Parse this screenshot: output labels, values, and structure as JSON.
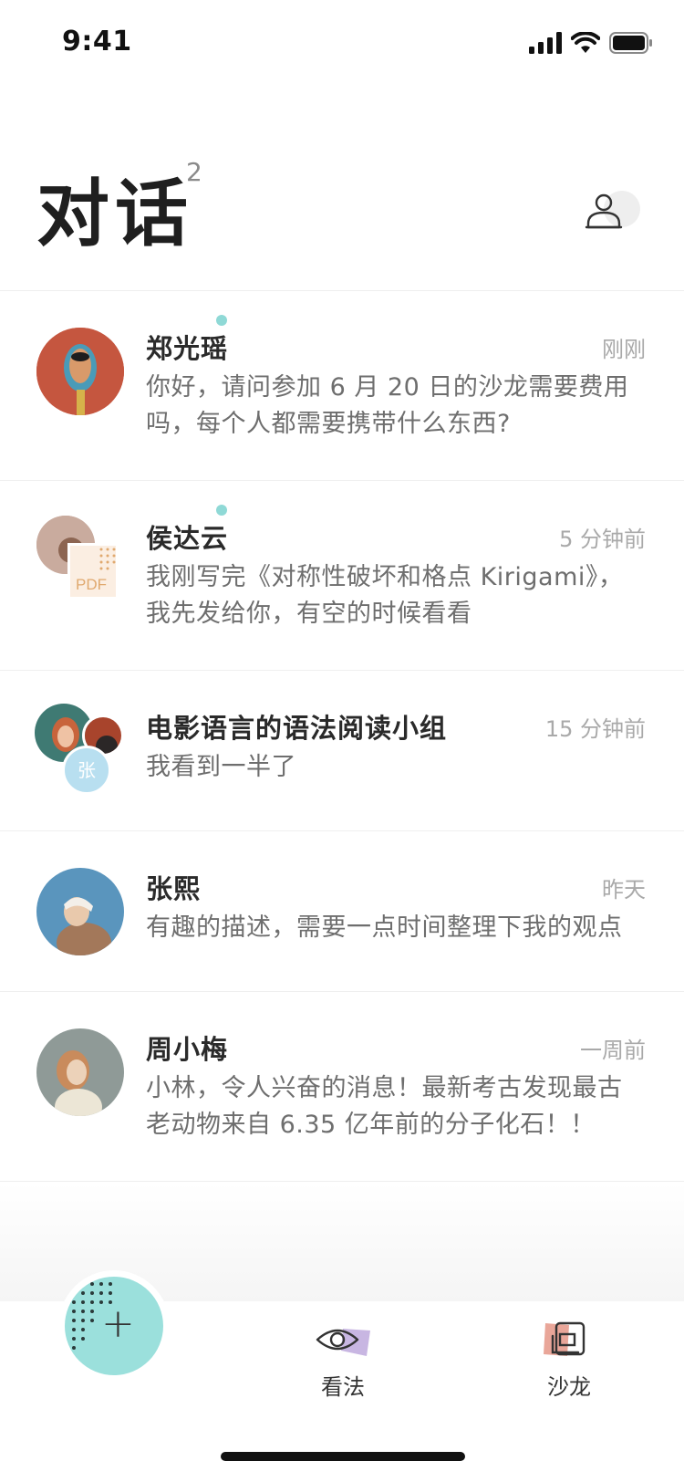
{
  "status_bar": {
    "time": "9:41"
  },
  "header": {
    "title": "对话",
    "badge": "2"
  },
  "conversations": [
    {
      "name": "郑光瑶",
      "time": "刚刚",
      "message": "你好，请问参加 6 月 20 日的沙龙需要费用吗，每个人都需要携带什么东西?",
      "online": true
    },
    {
      "name": "侯达云",
      "time": "5 分钟前",
      "message": "我刚写完《对称性破坏和格点 Kirigami》，我先发给你，有空的时候看看",
      "online": true,
      "attachment_label": "PDF"
    },
    {
      "name": "电影语言的语法阅读小组",
      "time": "15 分钟前",
      "message": "我看到一半了",
      "online": false,
      "member_initial": "张"
    },
    {
      "name": "张熙",
      "time": "昨天",
      "message": "有趣的描述，需要一点时间整理下我的观点",
      "online": false
    },
    {
      "name": "周小梅",
      "time": "一周前",
      "message": "小林，令人兴奋的消息！最新考古发现最古老动物来自 6.35 亿年前的分子化石！！",
      "online": false
    }
  ],
  "tab_bar": {
    "fab_label": "+",
    "tabs": [
      {
        "label": "看法",
        "icon": "eye-icon"
      },
      {
        "label": "沙龙",
        "icon": "salon-icon"
      }
    ]
  },
  "colors": {
    "accent": "#9be0dc",
    "online_dot": "#8fd9d6",
    "text_primary": "#2a2a2a",
    "text_secondary": "#6e6e6e",
    "text_muted": "#a9a9a9"
  }
}
